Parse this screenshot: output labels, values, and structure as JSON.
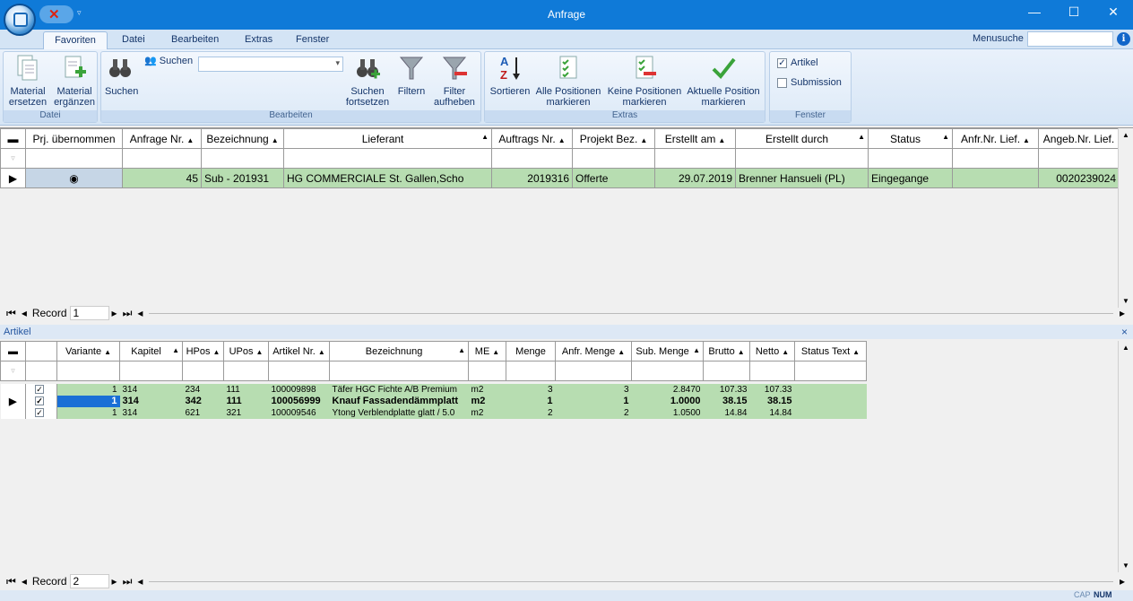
{
  "window": {
    "title": "Anfrage"
  },
  "tabs": [
    "Favoriten",
    "Datei",
    "Bearbeiten",
    "Extras",
    "Fenster"
  ],
  "menusuche": {
    "label": "Menusuche",
    "value": ""
  },
  "ribbon": {
    "groups": {
      "datei": "Datei",
      "bearbeiten": "Bearbeiten",
      "extras": "Extras",
      "fenster": "Fenster"
    },
    "material_ersetzen": "Material ersetzen",
    "material_ergaenzen": "Material ergänzen",
    "suchen": "Suchen",
    "suchen_small": "Suchen",
    "suchen_combo": "",
    "suchen_fortsetzen": "Suchen fortsetzen",
    "filtern": "Filtern",
    "filter_aufheben": "Filter aufheben",
    "sortieren": "Sortieren",
    "alle_positionen": "Alle Positionen markieren",
    "keine_positionen": "Keine Positionen markieren",
    "aktuelle_position": "Aktuelle Position markieren",
    "artikel_label": "Artikel",
    "artikel_checked": true,
    "submission_label": "Submission",
    "submission_checked": false
  },
  "top_grid": {
    "columns": [
      "Prj. übernommen",
      "Anfrage Nr.",
      "Bezeichnung",
      "Lieferant",
      "Auftrags Nr.",
      "Projekt Bez.",
      "Erstellt am",
      "Erstellt durch",
      "Status",
      "Anfr.Nr. Lief.",
      "Angeb.Nr. Lief."
    ],
    "row": {
      "anfrage_nr": "45",
      "bezeichnung": "Sub - 201931",
      "lieferant": "HG COMMERCIALE St. Gallen,Scho",
      "auftrags_nr": "2019316",
      "projekt_bez": "Offerte",
      "erstellt_am": "29.07.2019",
      "erstellt_durch": "Brenner Hansueli (PL)",
      "status": "Eingegange",
      "anfr_nr_lief": "",
      "angeb_nr_lief": "0020239024"
    },
    "record_label": "Record",
    "record_number": "1"
  },
  "artikel_panel": {
    "title": "Artikel",
    "close": "×"
  },
  "bottom_grid": {
    "columns": [
      "Variante",
      "Kapitel",
      "HPos",
      "UPos",
      "Artikel Nr.",
      "Bezeichnung",
      "ME",
      "Menge",
      "Anfr. Menge",
      "Sub. Menge",
      "Brutto",
      "Netto",
      "Status Text"
    ],
    "rows": [
      {
        "variante": "1",
        "kapitel": "314",
        "hpos": "234",
        "upos": "111",
        "artikel_nr": "100009898",
        "bezeichnung": "Täfer HGC Fichte A/B Premium",
        "me": "m2",
        "menge": "3",
        "anfr_menge": "3",
        "sub_menge": "2.8470",
        "brutto": "107.33",
        "netto": "107.33",
        "status_text": ""
      },
      {
        "variante": "1",
        "kapitel": "314",
        "hpos": "342",
        "upos": "111",
        "artikel_nr": "100056999",
        "bezeichnung": "Knauf Fassadendämmplatt",
        "me": "m2",
        "menge": "1",
        "anfr_menge": "1",
        "sub_menge": "1.0000",
        "brutto": "38.15",
        "netto": "38.15",
        "status_text": ""
      },
      {
        "variante": "1",
        "kapitel": "314",
        "hpos": "621",
        "upos": "321",
        "artikel_nr": "100009546",
        "bezeichnung": "Ytong Verblendplatte glatt / 5.0",
        "me": "m2",
        "menge": "2",
        "anfr_menge": "2",
        "sub_menge": "1.0500",
        "brutto": "14.84",
        "netto": "14.84",
        "status_text": ""
      }
    ],
    "record_label": "Record",
    "record_number": "2"
  },
  "statusbar": {
    "cap": "CAP",
    "num": "NUM"
  }
}
